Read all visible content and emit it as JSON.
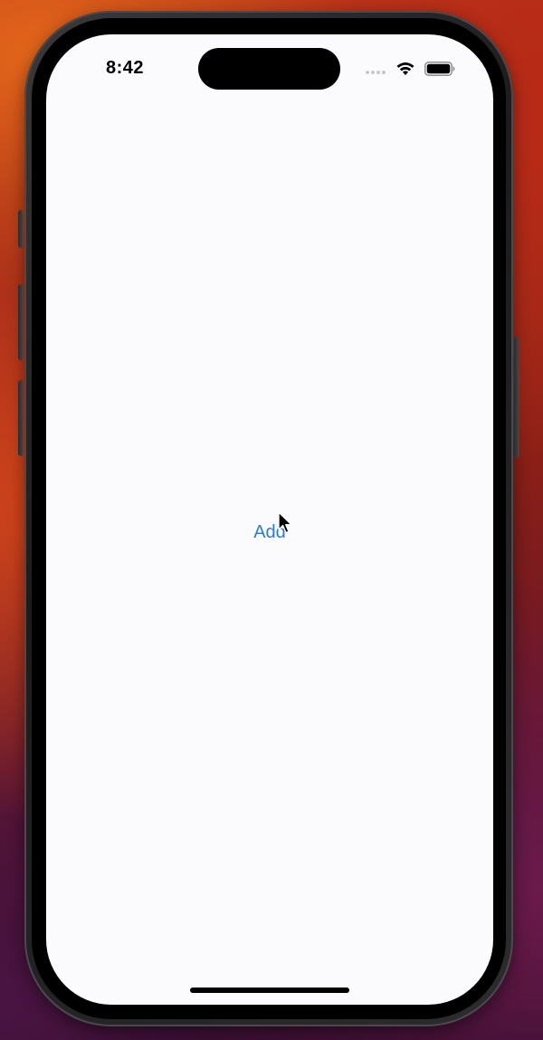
{
  "theme": {
    "accent": "#2c7bd6",
    "screen_background": "#fbfafd"
  },
  "status_bar": {
    "time": "8:42",
    "icons": [
      "signal-dots-icon",
      "wifi-icon",
      "battery-icon"
    ]
  },
  "main": {
    "add_label": "Add"
  },
  "cursor": {
    "icon": "arrow-pointer-icon"
  }
}
